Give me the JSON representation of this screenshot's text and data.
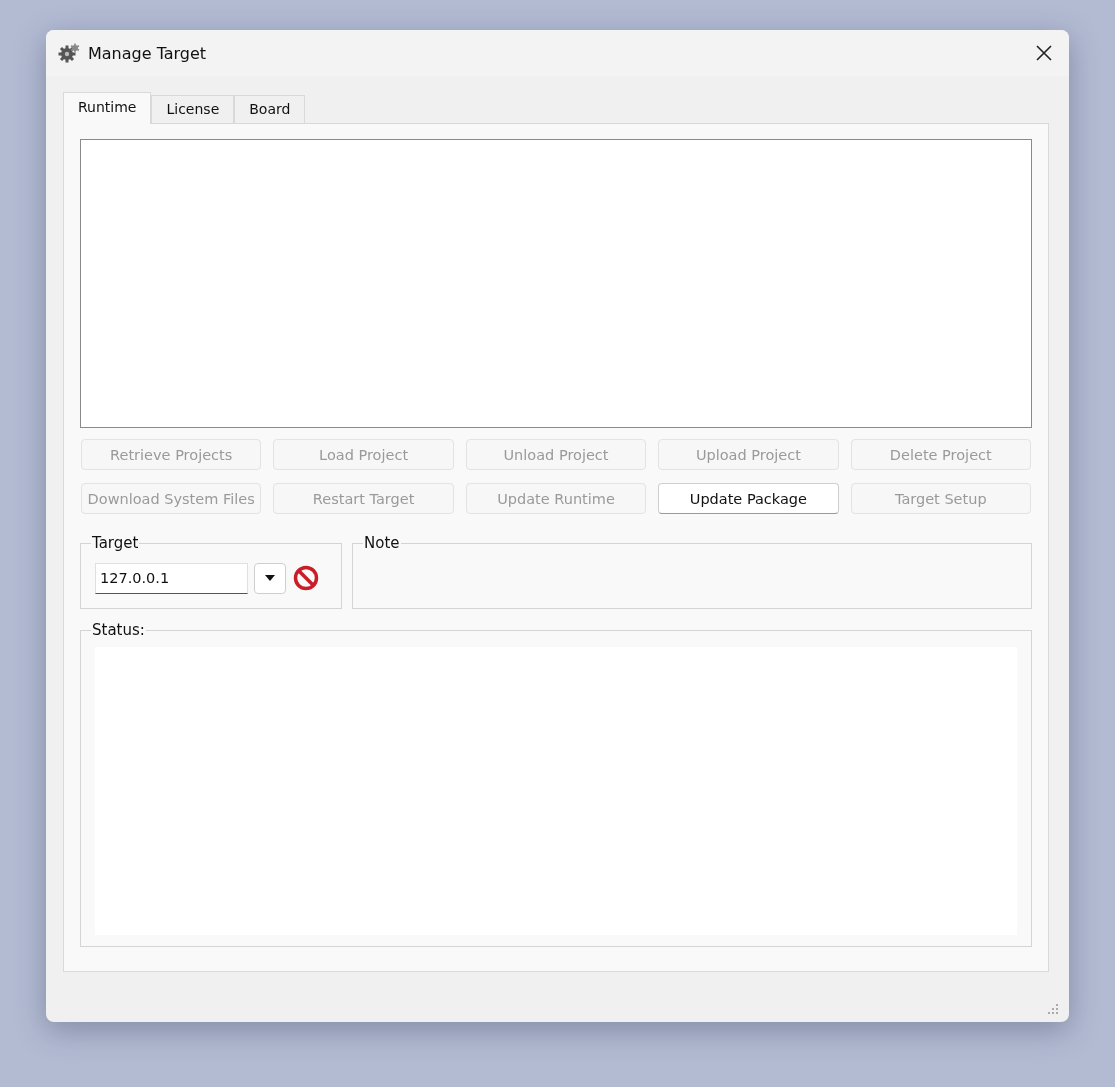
{
  "window": {
    "title": "Manage Target"
  },
  "tabs": [
    {
      "label": "Runtime",
      "selected": true
    },
    {
      "label": "License",
      "selected": false
    },
    {
      "label": "Board",
      "selected": false
    }
  ],
  "buttons": [
    {
      "label": "Retrieve Projects",
      "disabled": true
    },
    {
      "label": "Load Project",
      "disabled": true
    },
    {
      "label": "Unload Project",
      "disabled": true
    },
    {
      "label": "Upload Project",
      "disabled": true
    },
    {
      "label": "Delete Project",
      "disabled": true
    },
    {
      "label": "Download System Files",
      "disabled": true
    },
    {
      "label": "Restart Target",
      "disabled": true
    },
    {
      "label": "Update Runtime",
      "disabled": true
    },
    {
      "label": "Update Package",
      "disabled": false
    },
    {
      "label": "Target Setup",
      "disabled": true
    }
  ],
  "target": {
    "title": "Target",
    "value": "127.0.0.1"
  },
  "note": {
    "title": "Note"
  },
  "status": {
    "title": "Status:"
  }
}
